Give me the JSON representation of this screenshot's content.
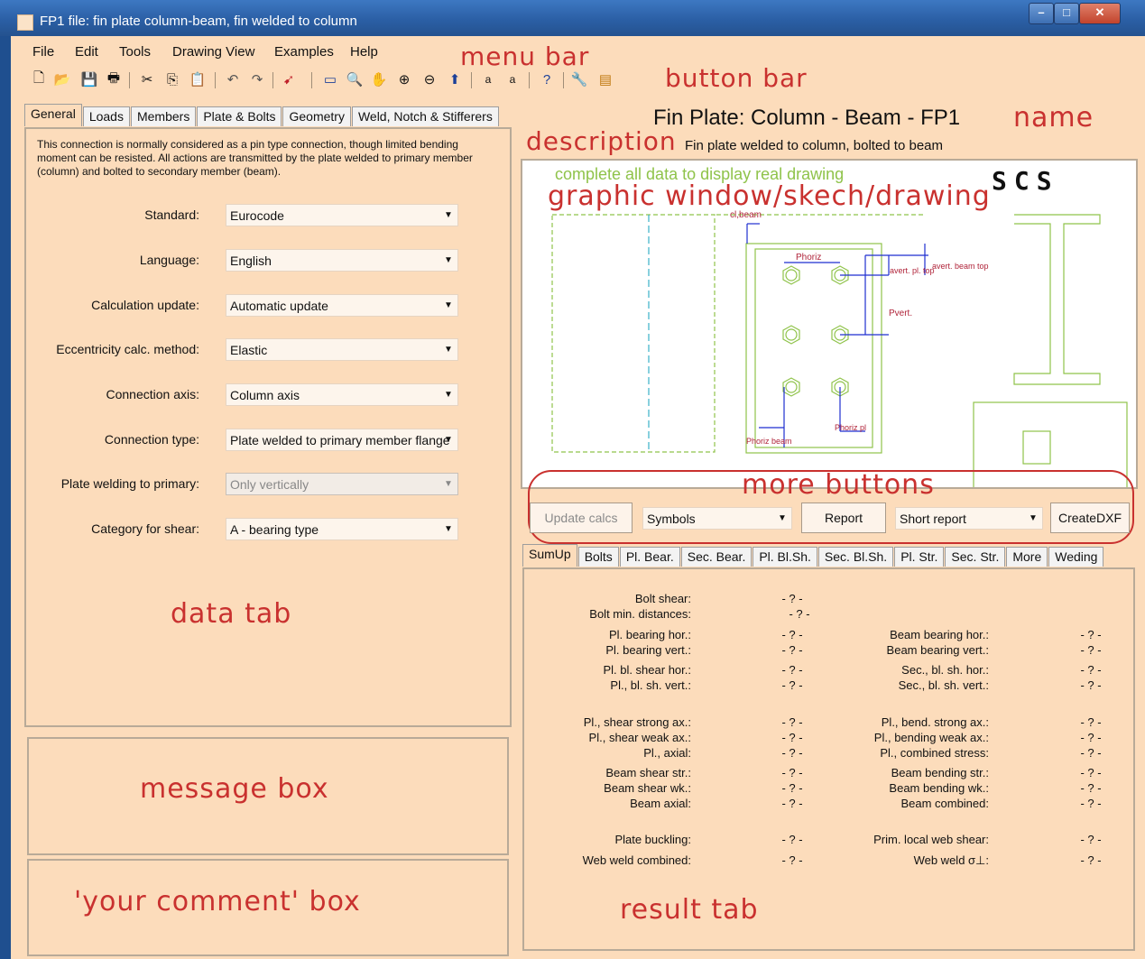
{
  "window": {
    "title": "FP1 file: fin plate column-beam, fin welded to column",
    "min": "–",
    "max": "□",
    "close": "✕"
  },
  "menu": {
    "items": [
      "File",
      "Edit",
      "Tools",
      "Drawing View",
      "Examples",
      "Help"
    ]
  },
  "toolbar": {
    "icons": [
      "new-icon",
      "open-icon",
      "save-icon",
      "print-icon",
      "cut-icon",
      "copy-icon",
      "paste-icon",
      "undo-icon",
      "redo-icon",
      "pointer-icon",
      "frame-icon",
      "zoom-icon",
      "hand-icon",
      "zoom-in-icon",
      "zoom-out-icon",
      "fit-icon",
      "text-a-icon",
      "text-b-icon",
      "help-icon",
      "tool-icon",
      "export-icon"
    ]
  },
  "annotations": {
    "menu_bar": "menu bar",
    "button_bar": "button bar",
    "name": "name",
    "description": "description",
    "graphic": "graphic window/skech/drawing",
    "more_buttons": "more buttons",
    "data_tab": "data tab",
    "message_box": "message box",
    "comment_box": "'your comment' box",
    "result_tab": "result tab"
  },
  "data_tabs": [
    "General",
    "Loads",
    "Members",
    "Plate & Bolts",
    "Geometry",
    "Weld, Notch & Stifferers"
  ],
  "general": {
    "description": "This connection is normally considered as a pin type connection, though limited bending moment can be resisted. All actions are transmitted by the plate welded to primary member (column) and bolted to secondary member (beam).",
    "fields": [
      {
        "label": "Standard:",
        "value": "Eurocode"
      },
      {
        "label": "Language:",
        "value": "English"
      },
      {
        "label": "Calculation update:",
        "value": "Automatic update"
      },
      {
        "label": "Eccentricity calc. method:",
        "value": "Elastic"
      },
      {
        "label": "Connection axis:",
        "value": "Column axis"
      },
      {
        "label": "Connection type:",
        "value": "Plate welded to primary member flange"
      },
      {
        "label": "Plate welding to primary:",
        "value": "Only vertically"
      },
      {
        "label": "Category for shear:",
        "value": "A - bearing type"
      }
    ]
  },
  "header": {
    "name": "Fin Plate: Column - Beam - FP1",
    "description": "Fin plate welded to column, bolted to beam"
  },
  "drawing": {
    "notice": "complete all data to display real drawing",
    "logo": "SCS",
    "labels": {
      "cl_beam": "cl,beam",
      "p_horiz": "Phoriz",
      "a_vert_pl_top": "avert. pl. top",
      "a_vert_beam_top": "avert. beam top",
      "p_vert": "Pvert.",
      "p_horiz_beam": "Phoriz beam",
      "p_horiz_pl": "Phoriz pl"
    }
  },
  "buttons": {
    "update": "Update calcs",
    "symbols": "Symbols",
    "report": "Report",
    "short_report": "Short report",
    "create_dxf": "CreateDXF"
  },
  "result_tabs": [
    "SumUp",
    "Bolts",
    "Pl. Bear.",
    "Sec. Bear.",
    "Pl. Bl.Sh.",
    "Sec. Bl.Sh.",
    "Pl. Str.",
    "Sec. Str.",
    "More",
    "Weding"
  ],
  "results": {
    "left": [
      {
        "label": "Bolt shear:",
        "value": "- ? -"
      },
      {
        "label": "Bolt min. distances:",
        "value": "- ? -"
      },
      {
        "label": "Pl. bearing hor.:",
        "value": "- ? -"
      },
      {
        "label": "Pl. bearing vert.:",
        "value": "- ? -"
      },
      {
        "label": "Pl. bl. shear hor.:",
        "value": "- ? -"
      },
      {
        "label": "Pl., bl. sh. vert.:",
        "value": "- ? -"
      },
      {
        "label": "Pl., shear strong ax.:",
        "value": "- ? -"
      },
      {
        "label": "Pl., shear weak ax.:",
        "value": "- ? -"
      },
      {
        "label": "Pl., axial:",
        "value": "- ? -"
      },
      {
        "label": "Beam shear str.:",
        "value": "- ? -"
      },
      {
        "label": "Beam shear wk.:",
        "value": "- ? -"
      },
      {
        "label": "Beam axial:",
        "value": "- ? -"
      },
      {
        "label": "Plate buckling:",
        "value": "- ? -"
      },
      {
        "label": "Web weld combined:",
        "value": "- ? -"
      }
    ],
    "right": [
      {
        "label": "Beam bearing hor.:",
        "value": "- ? -"
      },
      {
        "label": "Beam bearing vert.:",
        "value": "- ? -"
      },
      {
        "label": "Sec., bl. sh. hor.:",
        "value": "- ? -"
      },
      {
        "label": "Sec., bl. sh. vert.:",
        "value": "- ? -"
      },
      {
        "label": "Pl., bend. strong ax.:",
        "value": "- ? -"
      },
      {
        "label": "Pl., bending weak ax.:",
        "value": "- ? -"
      },
      {
        "label": "Pl., combined stress:",
        "value": "- ? -"
      },
      {
        "label": "Beam bending str.:",
        "value": "- ? -"
      },
      {
        "label": "Beam bending wk.:",
        "value": "- ? -"
      },
      {
        "label": "Beam combined:",
        "value": "- ? -"
      },
      {
        "label": "Prim. local web shear:",
        "value": "- ? -"
      },
      {
        "label": "Web weld σ⊥:",
        "value": "- ? -"
      }
    ]
  },
  "colors": {
    "panel": "#fcdcbb",
    "annotation": "#c9312f",
    "drawing_green": "#8fc34a",
    "drawing_blue": "#1f2fd0",
    "drawing_red": "#b0243a"
  }
}
